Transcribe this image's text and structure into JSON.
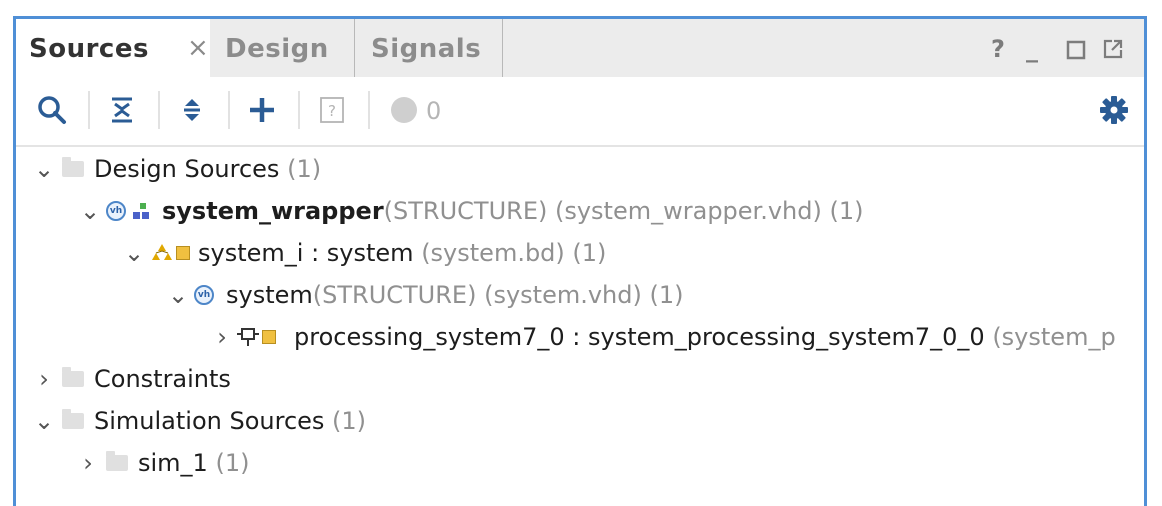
{
  "tabs": [
    {
      "label": "Sources",
      "close": "×"
    },
    {
      "label": "Design"
    },
    {
      "label": "Signals"
    }
  ],
  "window_controls": {
    "help": "?",
    "minimize": "_"
  },
  "toolbar": {
    "message_count": "0"
  },
  "tree": {
    "design_sources": {
      "label": "Design Sources",
      "count": "(1)"
    },
    "wrapper": {
      "name": "system_wrapper",
      "arch": "(STRUCTURE)",
      "file": "(system_wrapper.vhd) (1)"
    },
    "system_i": {
      "name": "system_i : system",
      "file": "(system.bd) (1)"
    },
    "system": {
      "name": "system",
      "arch": "(STRUCTURE)",
      "file": "(system.vhd) (1)"
    },
    "ps7": {
      "name": "processing_system7_0 : system_processing_system7_0_0",
      "file": "(system_p"
    },
    "constraints": {
      "label": "Constraints"
    },
    "simulation": {
      "label": "Simulation Sources",
      "count": "(1)"
    },
    "sim_1": {
      "label": "sim_1",
      "count": "(1)"
    }
  }
}
